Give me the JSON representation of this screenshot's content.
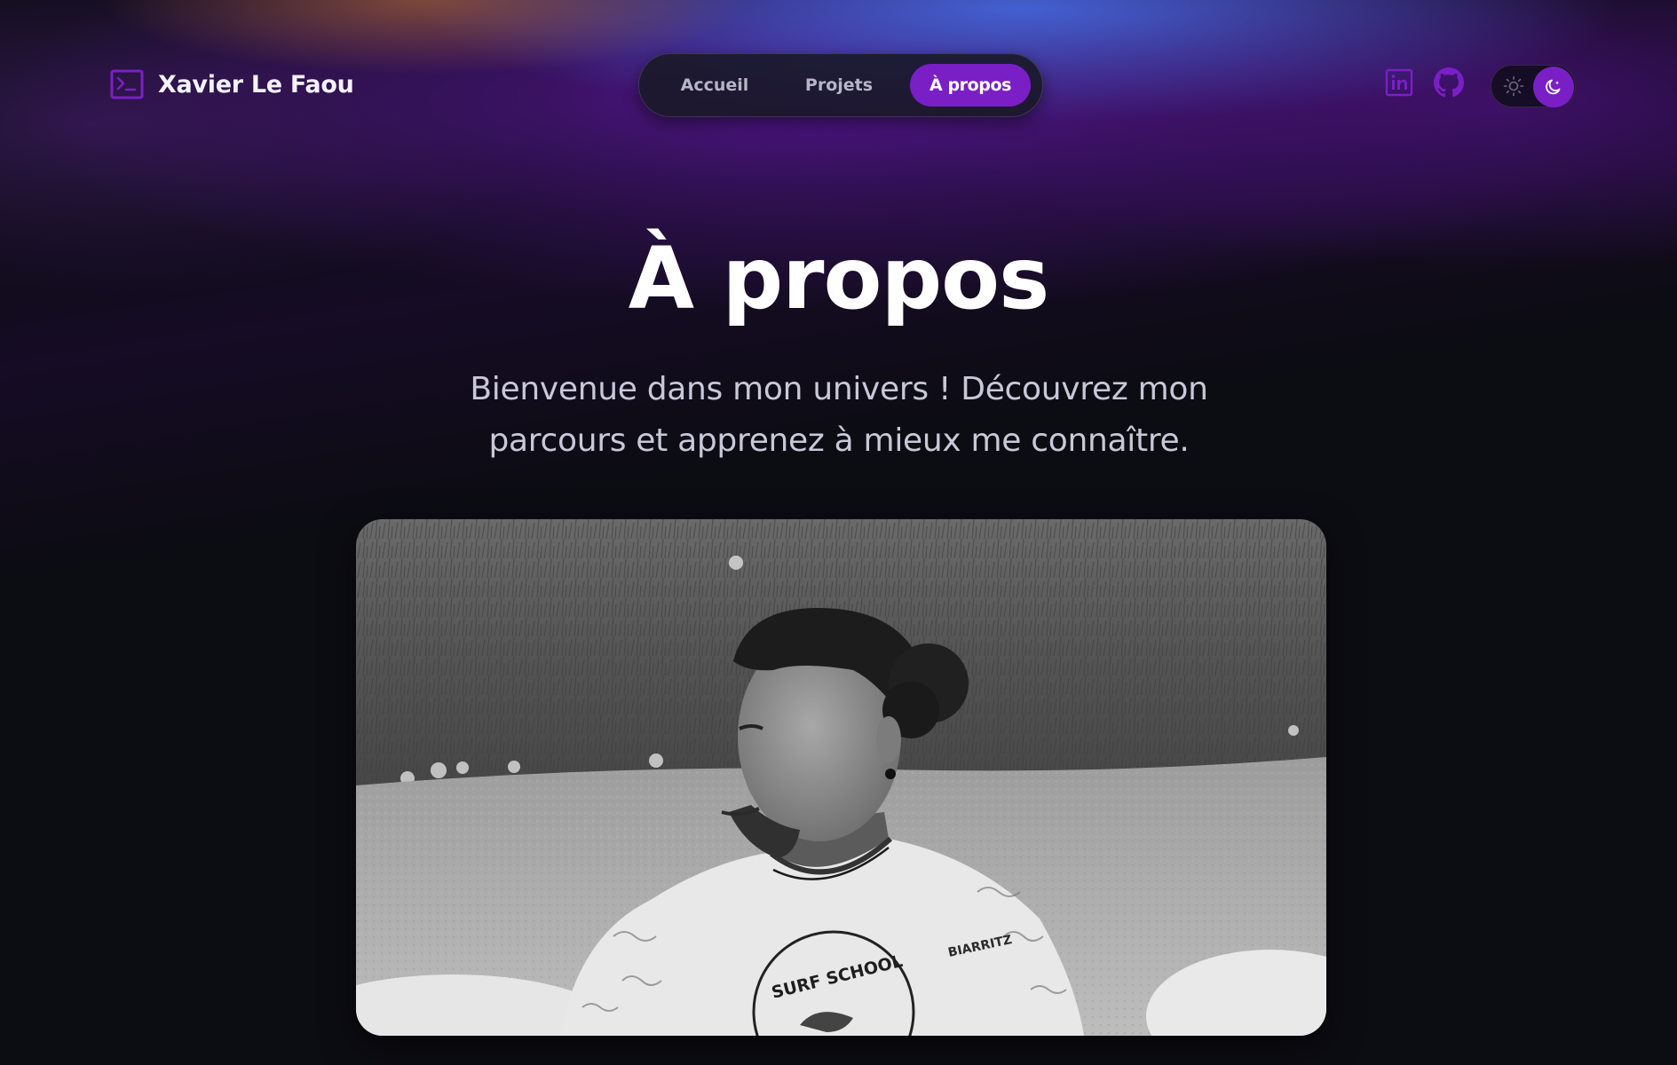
{
  "header": {
    "brand_name": "Xavier Le Faou",
    "brand_icon": "terminal-prompt-icon",
    "nav": [
      {
        "label": "Accueil",
        "active": false
      },
      {
        "label": "Projets",
        "active": false
      },
      {
        "label": "À propos",
        "active": true
      }
    ],
    "social": [
      {
        "icon": "linkedin-icon"
      },
      {
        "icon": "github-icon"
      }
    ],
    "theme_toggle": {
      "options": [
        "sun-icon",
        "moon-icon"
      ],
      "selected": "moon-icon"
    }
  },
  "hero": {
    "title": "À propos",
    "subtitle": "Bienvenue dans mon univers ! Découvrez mon parcours et apprenez à mieux me connaître."
  },
  "photo": {
    "text_on_shirt": "SURF SCHOOL",
    "text_on_sleeve": "BIARRITZ"
  },
  "colors": {
    "accent": "#7a1fc6",
    "background": "#0c0c13",
    "text_primary": "#ffffff",
    "text_secondary": "#c9c8d8",
    "nav_inactive": "#b6b6c6"
  }
}
